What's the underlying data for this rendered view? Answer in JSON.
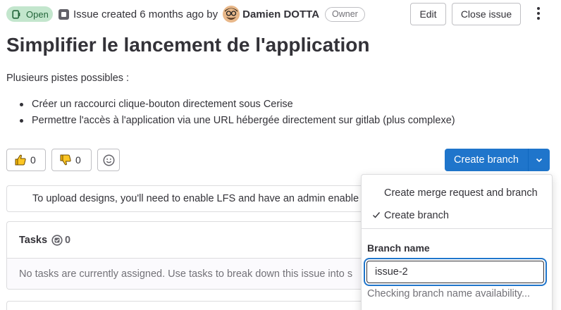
{
  "header": {
    "status": "Open",
    "created_text": "Issue created 6 months ago by",
    "author": "Damien DOTTA",
    "author_role": "Owner",
    "edit_label": "Edit",
    "close_label": "Close issue"
  },
  "issue": {
    "title": "Simplifier le lancement de l'application",
    "intro": "Plusieurs pistes possibles :",
    "items": [
      "Créer un raccourci clique-bouton directement sous Cerise",
      "Permettre l'accès à l'application via une URL hébergée directement sur gitlab (plus complexe)"
    ]
  },
  "awards": {
    "thumbs_up_count": "0",
    "thumbs_down_count": "0"
  },
  "create_branch": {
    "label": "Create branch"
  },
  "dropdown": {
    "option_mr": "Create merge request and branch",
    "option_branch": "Create branch",
    "branch_name_label": "Branch name",
    "branch_name_value": "issue-2",
    "availability_text": "Checking branch name availability..."
  },
  "lfs": {
    "message": "To upload designs, you'll need to enable LFS and have an admin enable"
  },
  "tasks": {
    "title": "Tasks",
    "count": "0",
    "empty_text": "No tasks are currently assigned. Use tasks to break down this issue into s"
  },
  "colors": {
    "status_bg": "#c3e6cd",
    "status_text": "#24663b",
    "primary": "#1f75cb"
  }
}
